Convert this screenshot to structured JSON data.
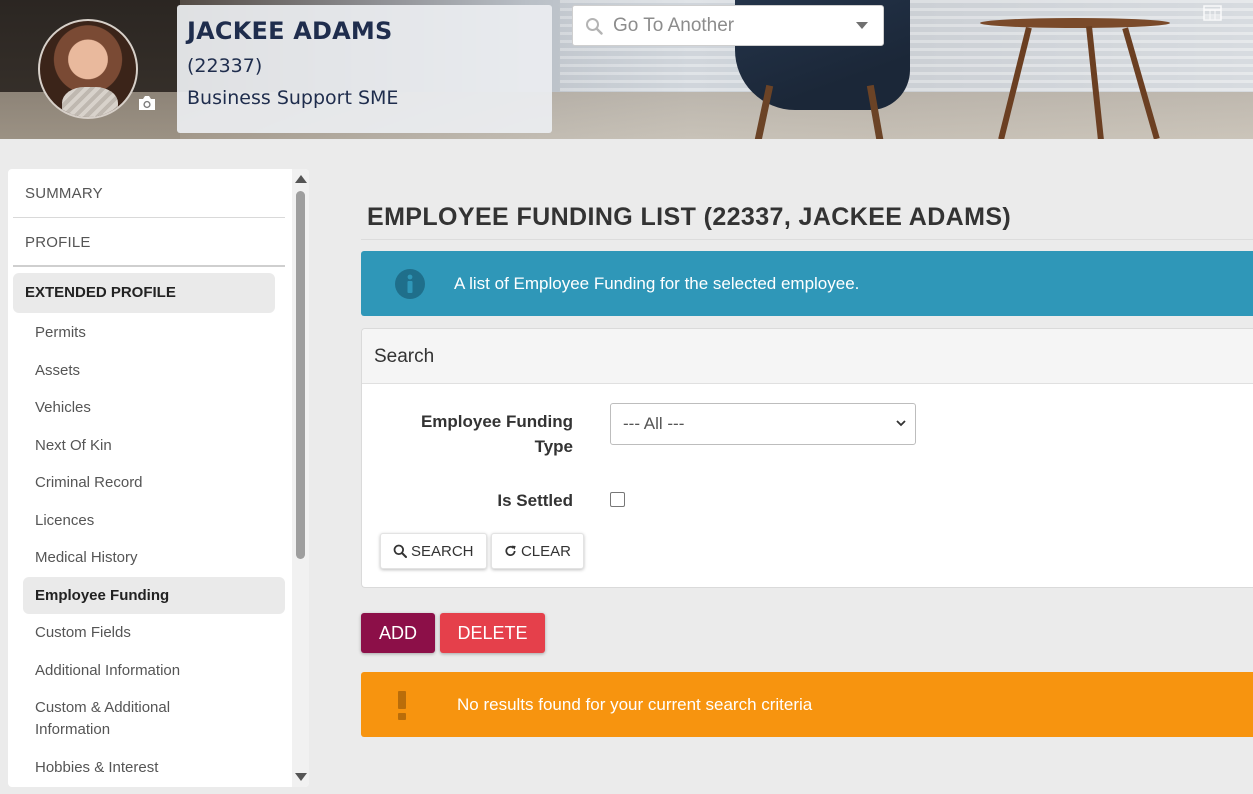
{
  "header": {
    "employee_name": "JACKEE ADAMS",
    "employee_id": "(22337)",
    "employee_title": "Business Support SME",
    "goto_placeholder": "Go To Another",
    "icons": [
      "camera-icon",
      "search-icon",
      "chevron-down-icon",
      "calendar-grid-icon"
    ]
  },
  "sidebar": {
    "top_items": [
      {
        "label": "SUMMARY"
      },
      {
        "label": "PROFILE"
      }
    ],
    "section": {
      "label": "EXTENDED PROFILE"
    },
    "items": [
      {
        "label": "Permits"
      },
      {
        "label": "Assets"
      },
      {
        "label": "Vehicles"
      },
      {
        "label": "Next Of Kin"
      },
      {
        "label": "Criminal Record"
      },
      {
        "label": "Licences"
      },
      {
        "label": "Medical History"
      },
      {
        "label": "Employee Funding",
        "active": true
      },
      {
        "label": "Custom Fields"
      },
      {
        "label": "Additional Information"
      },
      {
        "label": "Custom & Additional Information"
      },
      {
        "label": "Hobbies & Interest"
      }
    ]
  },
  "main": {
    "page_title": "EMPLOYEE FUNDING LIST (22337, JACKEE ADAMS)",
    "info_message": "A list of Employee Funding for the selected employee.",
    "search_panel": {
      "heading": "Search",
      "funding_type_label": "Employee Funding Type",
      "funding_type_value": "--- All ---",
      "is_settled_label": "Is Settled",
      "is_settled_checked": false,
      "search_button": "SEARCH",
      "clear_button": "CLEAR"
    },
    "add_button": "ADD",
    "delete_button": "DELETE",
    "warning_message": "No results found for your current search criteria"
  },
  "colors": {
    "info": "#2f97b8",
    "warning": "#f7940f",
    "add": "#8c0f48",
    "delete": "#e5404b",
    "name": "#1f2d4d"
  }
}
